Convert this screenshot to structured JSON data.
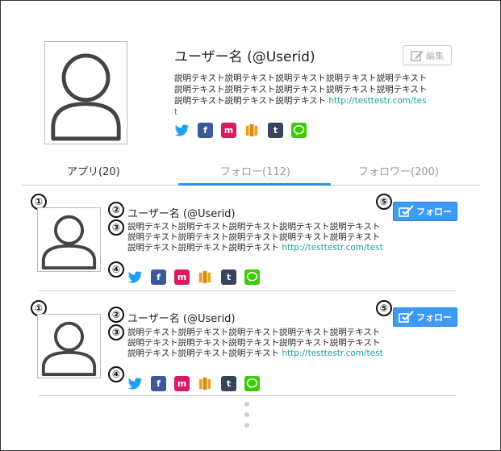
{
  "profile": {
    "name": "ユーザー名 (@Userid)",
    "description": "説明テキスト説明テキスト説明テキスト説明テキスト説明テキスト説明テキスト説明テキスト説明テキスト説明テキスト説明テキスト説明テキスト説明テキスト説明テキスト",
    "url": "http://testtestr.com/test",
    "edit_label": "編集",
    "sns": [
      "twitter-icon",
      "facebook-icon",
      "mixi-icon",
      "amazon-icon",
      "tumblr-icon",
      "line-icon"
    ]
  },
  "tabs": [
    {
      "label": "アプリ(20)"
    },
    {
      "label": "フォロー(112)"
    },
    {
      "label": "フォロワー(200)"
    }
  ],
  "active_tab": "フォロー(112)",
  "follow_list": [
    {
      "name": "ユーザー名 (@Userid)",
      "description": "説明テキスト説明テキスト説明テキスト説明テキスト説明テキスト説明テキスト説明テキスト説明テキスト説明テキスト説明テキスト説明テキスト説明テキスト説明テキスト",
      "url": "http://testtestr.com/test",
      "follow_label": "フォロー"
    },
    {
      "name": "ユーザー名 (@Userid)",
      "description": "説明テキスト説明テキスト説明テキスト説明テキスト説明テキスト説明テキスト説明テキスト説明テキスト説明テキスト説明テキスト説明テキスト説明テキスト説明テキスト",
      "url": "http://testtestr.com/test",
      "follow_label": "フォロー"
    }
  ],
  "markers": [
    "①",
    "②",
    "③",
    "④",
    "⑤"
  ],
  "colors": {
    "accent": "#2d8cf0",
    "follow_button": "#3d9af5",
    "link": "#1aa0a0",
    "inactive_tab": "#9a9a9a"
  }
}
